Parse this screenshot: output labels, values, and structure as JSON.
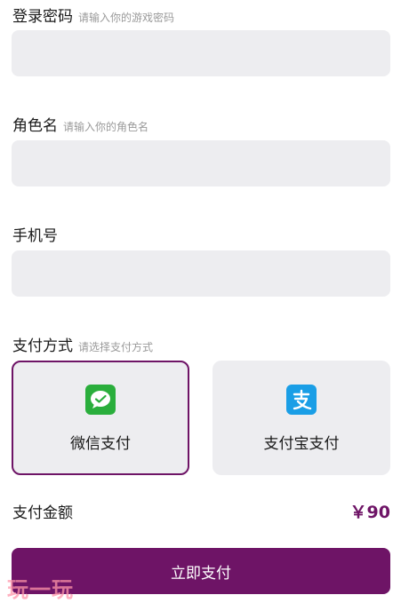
{
  "form": {
    "password": {
      "label": "登录密码",
      "hint": "请输入你的游戏密码",
      "value": ""
    },
    "role": {
      "label": "角色名",
      "hint": "请输入你的角色名",
      "value": ""
    },
    "phone": {
      "label": "手机号",
      "value": ""
    }
  },
  "payment": {
    "label": "支付方式",
    "hint": "请选择支付方式",
    "methods": [
      {
        "label": "微信支付",
        "icon": "wechat-pay-icon",
        "color": "#2aae3c",
        "selected": true
      },
      {
        "label": "支付宝支付",
        "icon": "alipay-icon",
        "color": "#1a9ee6",
        "selected": false
      }
    ]
  },
  "amount": {
    "label": "支付金额",
    "value": "￥90"
  },
  "submit": {
    "label": "立即支付"
  },
  "watermark": "玩一玩",
  "colors": {
    "accent": "#6e1466",
    "input_bg": "#ededf0"
  }
}
